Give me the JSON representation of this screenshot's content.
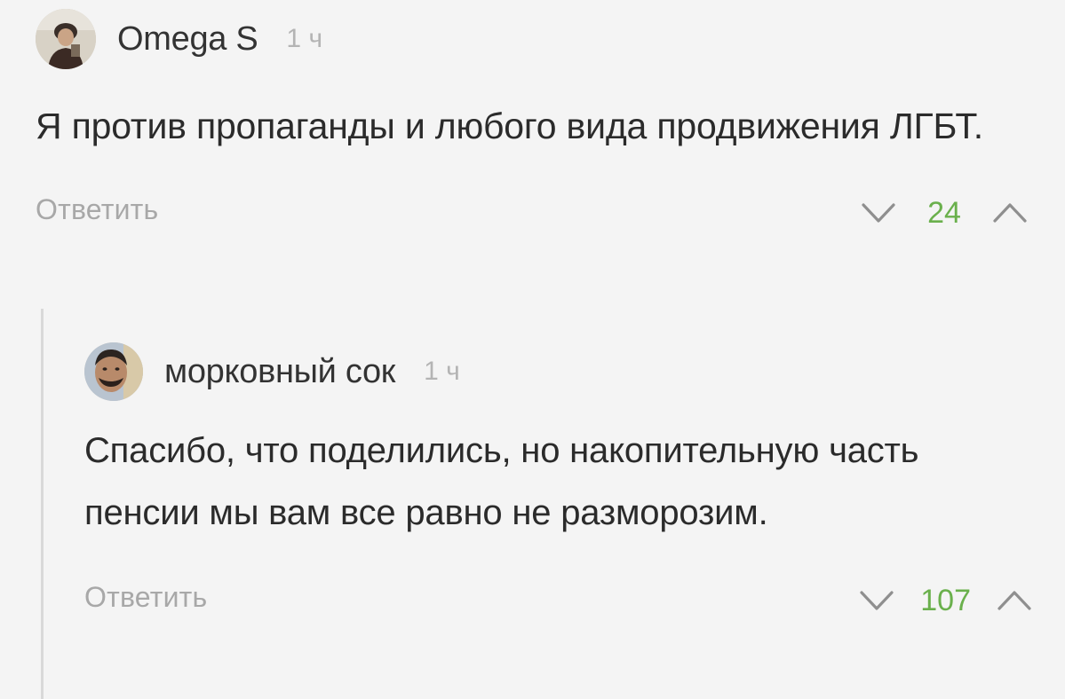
{
  "comments": [
    {
      "author": "Omega S",
      "time": "1 ч",
      "text": "Я против пропаганды и любого вида продвижения ЛГБТ.",
      "reply_label": "Ответить",
      "score": "24"
    },
    {
      "author": "морковный сок",
      "time": "1 ч",
      "text": "Спасибо, что поделились, но накопительную часть пенсии мы вам все равно не разморозим.",
      "reply_label": "Ответить",
      "score": "107"
    }
  ],
  "colors": {
    "background": "#f4f4f4",
    "score": "#6ab04c",
    "muted": "#a8a8a8",
    "thread_line": "#d9d9d9"
  },
  "icons": {
    "downvote": "chevron-down-icon",
    "upvote": "chevron-up-icon"
  }
}
